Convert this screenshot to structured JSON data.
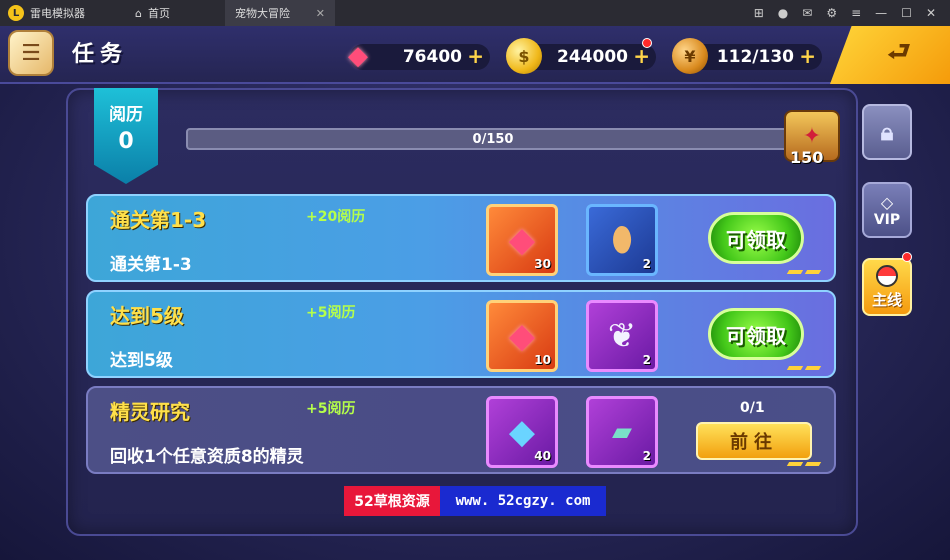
{
  "titlebar": {
    "app_name": "雷电模拟器",
    "tabs": [
      {
        "label": "首页"
      },
      {
        "label": "宠物大冒险"
      }
    ]
  },
  "header": {
    "title": "任务",
    "gems": "76400",
    "gold": "244000",
    "stamina": "112/130",
    "plus": "+"
  },
  "experience": {
    "label": "阅历",
    "value": "0",
    "progress_text": "0/150",
    "progress_fraction": 0,
    "chest_value": "150"
  },
  "tasks": [
    {
      "title": "通关第1-3",
      "exp": "+20阅历",
      "desc": "通关第1-3",
      "rewards": [
        {
          "icon": "gem-icon",
          "count": "30",
          "style": "orange"
        },
        {
          "icon": "egg-icon",
          "count": "2",
          "style": "blue"
        }
      ],
      "action": "可领取"
    },
    {
      "title": "达到5级",
      "exp": "+5阅历",
      "desc": "达到5级",
      "rewards": [
        {
          "icon": "gem-icon",
          "count": "10",
          "style": "orange"
        },
        {
          "icon": "feather-icon",
          "count": "2",
          "style": "purple"
        }
      ],
      "action": "可领取"
    },
    {
      "title": "精灵研究",
      "exp": "+5阅历",
      "desc": "回收1个任意资质8的精灵",
      "rewards": [
        {
          "icon": "crystal-icon",
          "count": "40",
          "style": "purple"
        },
        {
          "icon": "ticket-icon",
          "count": "2",
          "style": "purple"
        }
      ],
      "progress": "0/1",
      "action": "前往"
    }
  ],
  "side_buttons": {
    "vip": "VIP",
    "main": "主线"
  },
  "watermark": {
    "site_name": "52草根资源",
    "url": "www. 52cgzy. com"
  }
}
